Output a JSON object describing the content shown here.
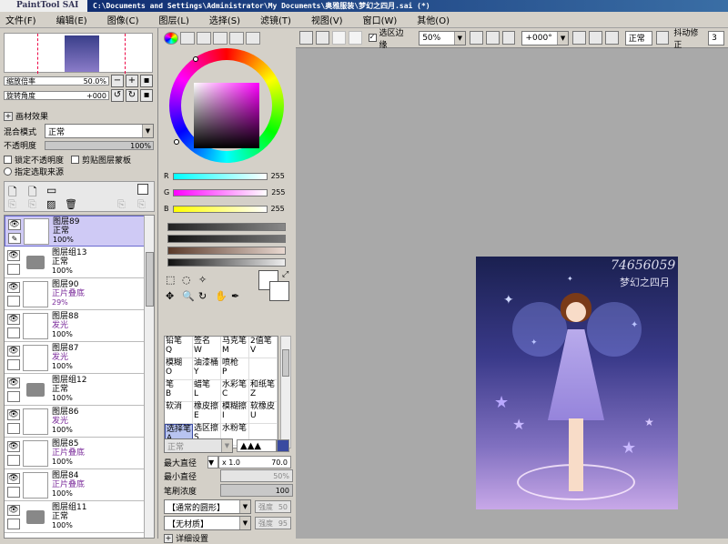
{
  "titlebar": {
    "logo": "PaintTool SAI",
    "path": "C:\\Documents and Settings\\Administrator\\My Documents\\奥雅服装\\梦幻之四月.sai (*)"
  },
  "menu": [
    "文件(F)",
    "编辑(E)",
    "图像(C)",
    "图层(L)",
    "选择(S)",
    "滤镜(T)",
    "视图(V)",
    "窗口(W)",
    "其他(O)"
  ],
  "navigator": {
    "zoom_label": "缩放倍率",
    "zoom_value": "50.0%",
    "rotate_label": "旋转角度",
    "rotate_value": "+000"
  },
  "layer_props": {
    "paper_effect": "画材效果",
    "blend_label": "混合模式",
    "blend_value": "正常",
    "opacity_label": "不透明度",
    "opacity_value": "100%",
    "lock_alpha": "锁定不透明度",
    "clip_group": "剪贴图层蒙板",
    "select_source": "指定选取来源"
  },
  "layers": [
    {
      "name": "图层89",
      "mode": "正常",
      "opacity": "100%",
      "type": "layer",
      "active": true,
      "mode_color": "normal"
    },
    {
      "name": "图层组13",
      "mode": "正常",
      "opacity": "100%",
      "type": "folder",
      "active": false,
      "mode_color": "normal"
    },
    {
      "name": "图层90",
      "mode": "正片叠底",
      "opacity": "29%",
      "type": "layer",
      "active": false,
      "mode_color": "purple"
    },
    {
      "name": "图层88",
      "mode": "发光",
      "opacity": "100%",
      "type": "layer",
      "active": false,
      "mode_color": "purple"
    },
    {
      "name": "图层87",
      "mode": "发光",
      "opacity": "100%",
      "type": "layer",
      "active": false,
      "mode_color": "purple"
    },
    {
      "name": "图层组12",
      "mode": "正常",
      "opacity": "100%",
      "type": "folder",
      "active": false,
      "mode_color": "normal"
    },
    {
      "name": "图层86",
      "mode": "发光",
      "opacity": "100%",
      "type": "layer",
      "active": false,
      "mode_color": "purple"
    },
    {
      "name": "图层85",
      "mode": "正片叠底",
      "opacity": "100%",
      "type": "layer",
      "active": false,
      "mode_color": "purple"
    },
    {
      "name": "图层84",
      "mode": "正片叠底",
      "opacity": "100%",
      "type": "layer",
      "active": false,
      "mode_color": "purple"
    },
    {
      "name": "图层组11",
      "mode": "正常",
      "opacity": "100%",
      "type": "folder",
      "active": false,
      "mode_color": "normal"
    }
  ],
  "color": {
    "r_label": "R",
    "g_label": "G",
    "b_label": "B",
    "r": "255",
    "g": "255",
    "b": "255"
  },
  "tools": [
    {
      "label": "铅笔",
      "key": "Q"
    },
    {
      "label": "签名",
      "key": "W"
    },
    {
      "label": "马克笔",
      "key": "M"
    },
    {
      "label": "2值笔",
      "key": "V"
    },
    {
      "label": "模糊",
      "key": "O"
    },
    {
      "label": "油漆桶",
      "key": "Y"
    },
    {
      "label": "喷枪",
      "key": "P"
    },
    {
      "label": "",
      "key": ""
    },
    {
      "label": "笔",
      "key": "B"
    },
    {
      "label": "蜡笔",
      "key": "L"
    },
    {
      "label": "水彩笔",
      "key": "C"
    },
    {
      "label": "和纸笔",
      "key": "Z"
    },
    {
      "label": "软消",
      "key": ""
    },
    {
      "label": "橡皮擦",
      "key": "E"
    },
    {
      "label": "模糊擦",
      "key": "I"
    },
    {
      "label": "软橡皮",
      "key": "U"
    },
    {
      "label": "选择笔",
      "key": "A"
    },
    {
      "label": "选区擦",
      "key": "S"
    },
    {
      "label": "水粉笔",
      "key": ""
    },
    {
      "label": "",
      "key": ""
    }
  ],
  "brush": {
    "mode_value": "正常",
    "max_label": "最大直径",
    "max_mult": "x 1.0",
    "max_value": "70.0",
    "min_label": "最小直径",
    "min_value": "50%",
    "density_label": "笔刷浓度",
    "density_value": "100",
    "shape_value": "【通常的圆形】",
    "shape_strength_label": "强度",
    "shape_strength": "50",
    "texture_value": "【无材质】",
    "texture_strength_label": "强度",
    "texture_strength": "95",
    "more": "详细设置"
  },
  "canvas_toolbar": {
    "selection_edge": "选区边缘",
    "zoom": "50%",
    "rotation": "+000°",
    "mode": "正常",
    "stabilizer_label": "抖动修正",
    "stabilizer": "3"
  },
  "artwork": {
    "sig_number": "74656059",
    "sig_text": "梦幻之四月"
  }
}
